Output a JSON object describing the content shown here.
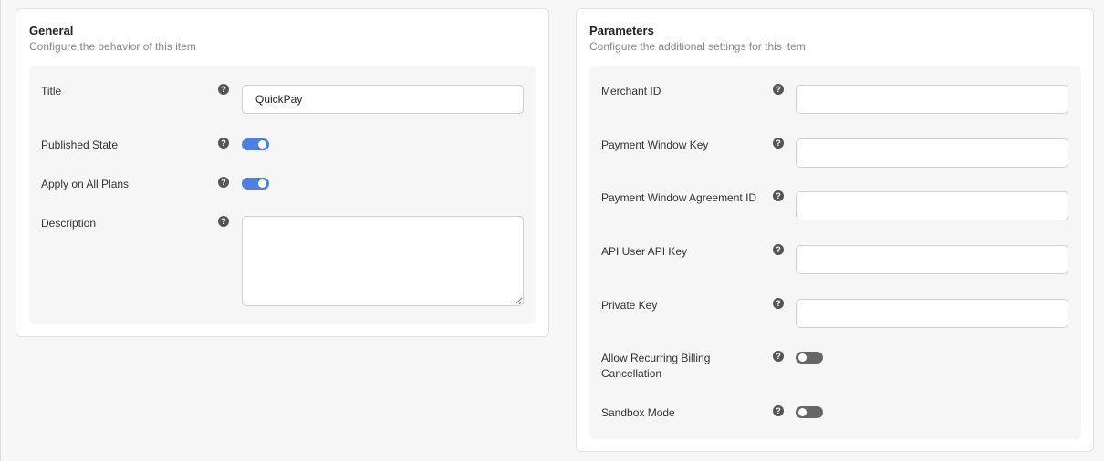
{
  "general": {
    "title": "General",
    "subtitle": "Configure the behavior of this item",
    "fields": {
      "title_label": "Title",
      "title_value": "QuickPay",
      "published_label": "Published State",
      "published_on": true,
      "apply_label": "Apply on All Plans",
      "apply_on": true,
      "description_label": "Description",
      "description_value": ""
    }
  },
  "parameters": {
    "title": "Parameters",
    "subtitle": "Configure the additional settings for this item",
    "fields": {
      "merchant_id_label": "Merchant ID",
      "merchant_id_value": "",
      "payment_window_key_label": "Payment Window Key",
      "payment_window_key_value": "",
      "payment_window_agreement_label": "Payment Window Agreement ID",
      "payment_window_agreement_value": "",
      "api_user_key_label": "API User API Key",
      "api_user_key_value": "",
      "private_key_label": "Private Key",
      "private_key_value": "",
      "recurring_label_line1": "Allow Recurring Billing",
      "recurring_label_line2": "Cancellation",
      "recurring_on": false,
      "sandbox_label": "Sandbox Mode",
      "sandbox_on": false
    }
  },
  "icons": {
    "help": "question-circle-icon"
  },
  "colors": {
    "toggle_on": "#4f7fe0",
    "toggle_off": "#666666"
  }
}
